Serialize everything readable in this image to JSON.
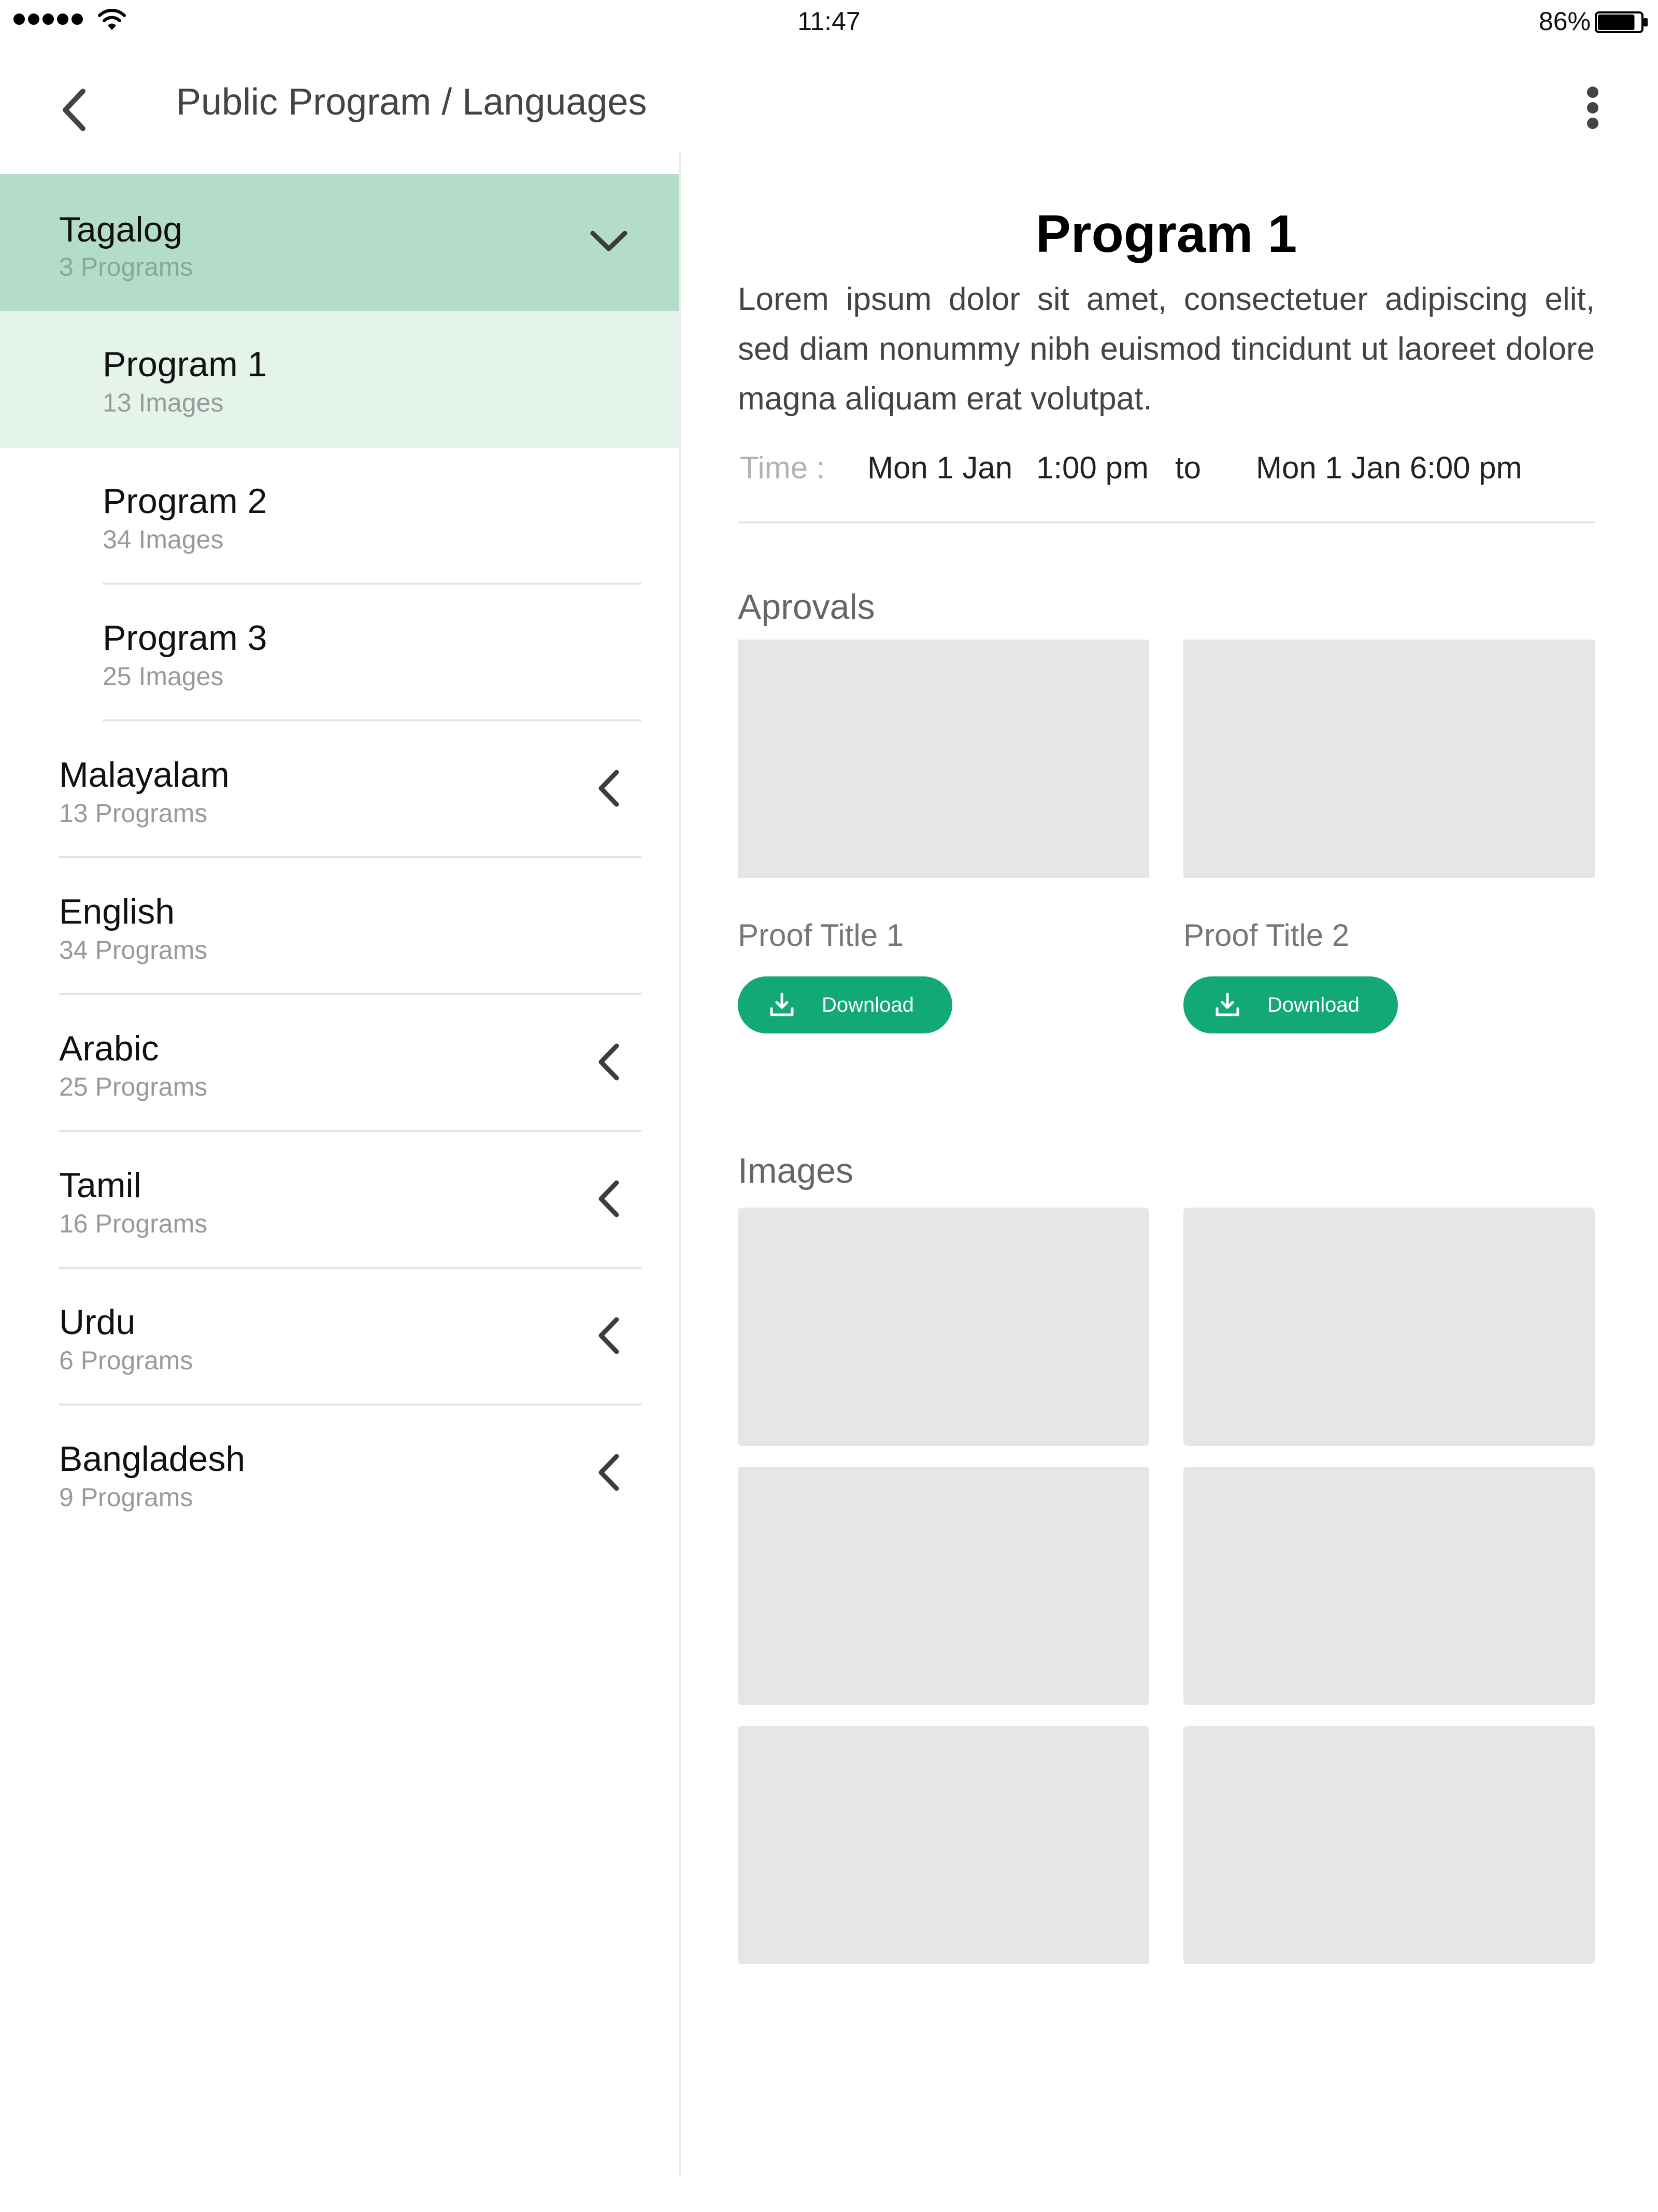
{
  "status_bar": {
    "time": "11:47",
    "battery": "86%",
    "battery_level": 0.86
  },
  "header": {
    "title": "Public Program / Languages"
  },
  "sidebar": {
    "languages": [
      {
        "name": "Tagalog",
        "count": "3 Programs",
        "expanded": true,
        "programs": [
          {
            "name": "Program 1",
            "count": "13 Images",
            "active": true
          },
          {
            "name": "Program 2",
            "count": "34 Images"
          },
          {
            "name": "Program 3",
            "count": "25 Images"
          }
        ]
      },
      {
        "name": "Malayalam",
        "count": "13 Programs",
        "chevron": "chevron-left-icon"
      },
      {
        "name": "English",
        "count": "34 Programs"
      },
      {
        "name": "Arabic",
        "count": "25 Programs",
        "chevron": "chevron-left-icon"
      },
      {
        "name": "Tamil",
        "count": "16 Programs",
        "chevron": "chevron-left-icon"
      },
      {
        "name": "Urdu",
        "count": "6 Programs",
        "chevron": "chevron-left-icon"
      },
      {
        "name": "Bangladesh",
        "count": "9 Programs",
        "chevron": "chevron-left-icon"
      }
    ]
  },
  "main": {
    "title": "Program 1",
    "description": "Lorem ipsum dolor sit amet, consectetuer adipiscing elit, sed diam nonummy nibh euismod tincidunt ut laoreet dolore magna aliquam erat volutpat.",
    "time": {
      "label": "Time :",
      "start_date": "Mon 1 Jan",
      "start_time": "1:00 pm",
      "separator": "to",
      "end": "Mon 1 Jan 6:00 pm"
    },
    "approvals_title": "Aprovals",
    "proofs": [
      {
        "title": "Proof Title 1",
        "button": "Download"
      },
      {
        "title": "Proof Title 2",
        "button": "Download"
      }
    ],
    "images_title": "Images"
  },
  "colors": {
    "accent": "#12a878",
    "expanded_bg": "#b3ddc8",
    "active_bg": "#e4f4ea",
    "placeholder": "#e6e6e6"
  }
}
